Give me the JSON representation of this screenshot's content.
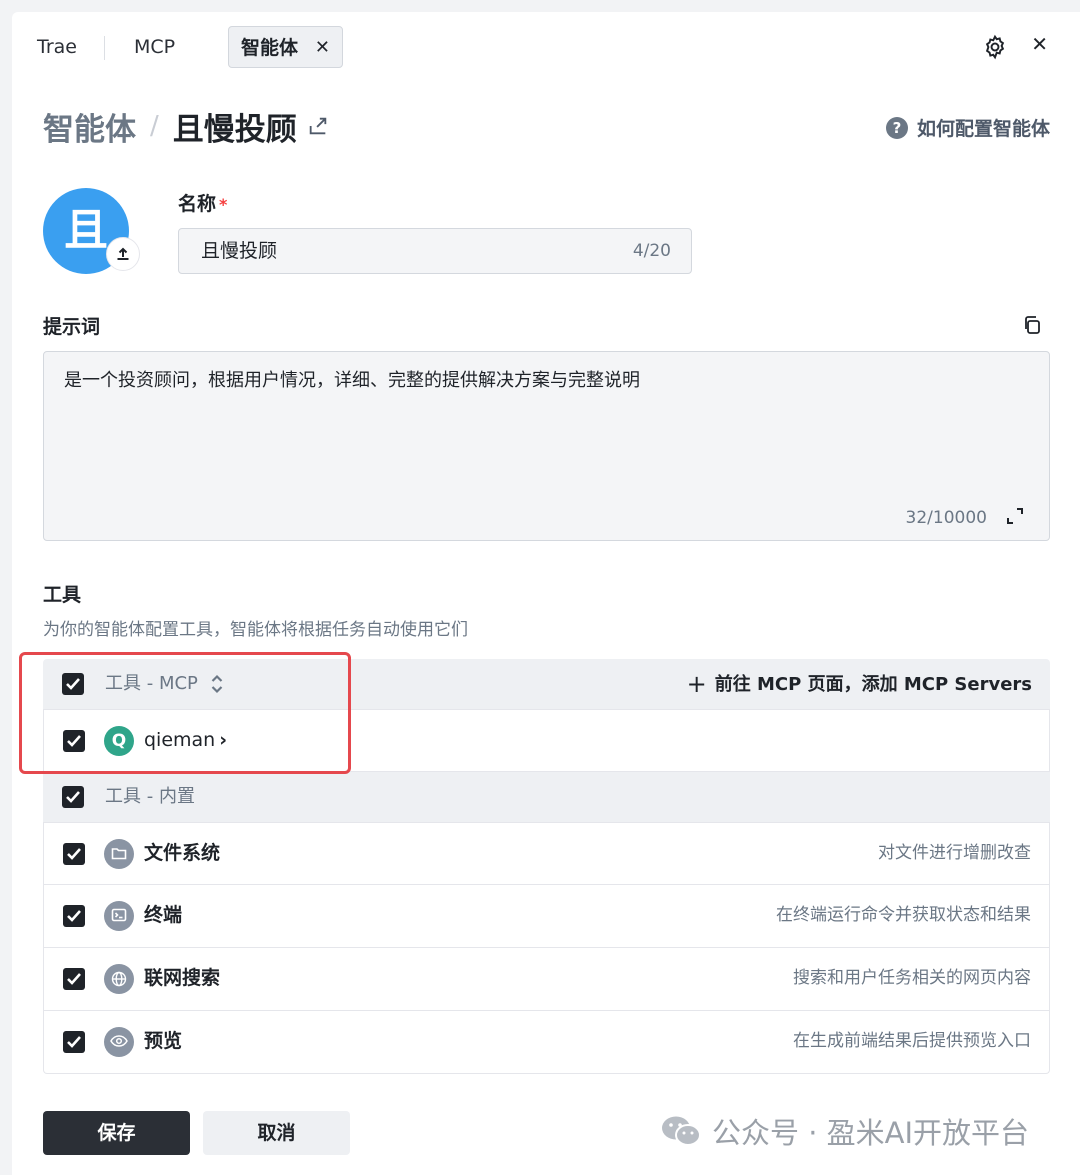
{
  "tabs": {
    "trae": "Trae",
    "mcp": "MCP",
    "agent": "智能体",
    "close": "✕"
  },
  "breadcrumb": {
    "root": "智能体",
    "sep": "/",
    "current": "且慢投顾"
  },
  "help": {
    "label": "如何配置智能体",
    "icon": "?"
  },
  "avatar": {
    "letter": "且",
    "color": "#3a9ff0"
  },
  "name": {
    "label": "名称",
    "required": "*",
    "value": "且慢投顾",
    "count": "4/20"
  },
  "prompt": {
    "label": "提示词",
    "value": "是一个投资顾问，根据用户情况，详细、完整的提供解决方案与完整说明",
    "count": "32/10000"
  },
  "tools": {
    "title": "工具",
    "description": "为你的智能体配置工具，智能体将根据任务自动使用它们",
    "mcp_group": {
      "title": "工具 - MCP",
      "add_link": "前往 MCP 页面，添加 MCP Servers",
      "add_plus": "+",
      "items": [
        {
          "name": "qieman",
          "icon_letter": "Q",
          "chevron": "›"
        }
      ]
    },
    "builtin_group": {
      "title": "工具 - 内置",
      "items": [
        {
          "name": "文件系统",
          "desc": "对文件进行增删改查",
          "icon": "folder-icon"
        },
        {
          "name": "终端",
          "desc": "在终端运行命令并获取状态和结果",
          "icon": "terminal-icon"
        },
        {
          "name": "联网搜索",
          "desc": "搜索和用户任务相关的网页内容",
          "icon": "globe-icon"
        },
        {
          "name": "预览",
          "desc": "在生成前端结果后提供预览入口",
          "icon": "eye-icon"
        }
      ]
    }
  },
  "footer": {
    "save": "保存",
    "cancel": "取消"
  },
  "watermark": {
    "text": "公众号 · 盈米AI开放平台"
  },
  "colors": {
    "accent_dark": "#2b2f36",
    "highlight": "#e5484d",
    "mcp_icon": "#2fa58a"
  }
}
